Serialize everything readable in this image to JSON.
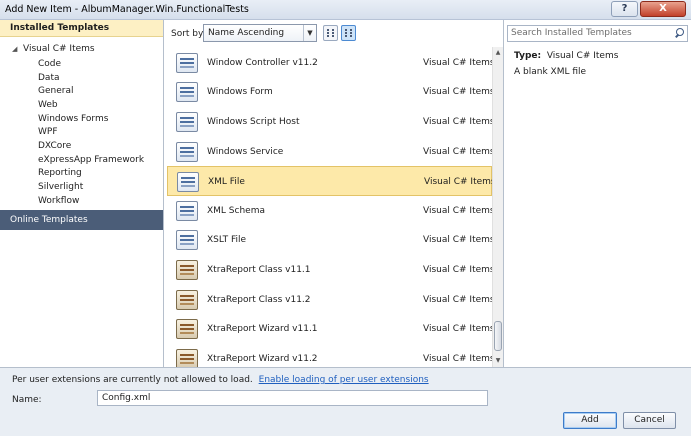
{
  "window": {
    "title": "Add New Item - AlbumManager.Win.FunctionalTests",
    "help_label": "?",
    "close_label": "X"
  },
  "sidebar": {
    "header": "Installed Templates",
    "root_label": "Visual C# Items",
    "items": [
      "Code",
      "Data",
      "General",
      "Web",
      "Windows Forms",
      "WPF",
      "DXCore",
      "eXpressApp Framework",
      "Reporting",
      "Silverlight",
      "Workflow"
    ],
    "online_label": "Online Templates"
  },
  "toolbar": {
    "sort_label": "Sort by:",
    "sort_value": "Name Ascending"
  },
  "templates": [
    {
      "name": "Window Controller v11.2",
      "category": "Visual C# Items",
      "icon": "window-controller-icon",
      "selected": false
    },
    {
      "name": "Windows Form",
      "category": "Visual C# Items",
      "icon": "windows-form-icon",
      "selected": false
    },
    {
      "name": "Windows Script Host",
      "category": "Visual C# Items",
      "icon": "script-host-icon",
      "selected": false
    },
    {
      "name": "Windows Service",
      "category": "Visual C# Items",
      "icon": "windows-service-icon",
      "selected": false
    },
    {
      "name": "XML File",
      "category": "Visual C# Items",
      "icon": "xml-file-icon",
      "selected": true
    },
    {
      "name": "XML Schema",
      "category": "Visual C# Items",
      "icon": "xml-schema-icon",
      "selected": false
    },
    {
      "name": "XSLT File",
      "category": "Visual C# Items",
      "icon": "xslt-file-icon",
      "selected": false
    },
    {
      "name": "XtraReport Class v11.1",
      "category": "Visual C# Items",
      "icon": "xtrareport-class-icon",
      "selected": false
    },
    {
      "name": "XtraReport Class v11.2",
      "category": "Visual C# Items",
      "icon": "xtrareport-class-icon",
      "selected": false
    },
    {
      "name": "XtraReport Wizard v11.1",
      "category": "Visual C# Items",
      "icon": "xtrareport-wizard-icon",
      "selected": false
    },
    {
      "name": "XtraReport Wizard v11.2",
      "category": "Visual C# Items",
      "icon": "xtrareport-wizard-icon",
      "selected": false
    }
  ],
  "details": {
    "search_placeholder": "Search Installed Templates",
    "type_label": "Type:",
    "type_value": "Visual C# Items",
    "description": "A blank XML file"
  },
  "footer": {
    "ext_message": "Per user extensions are currently not allowed to load.",
    "ext_link": "Enable loading of per user extensions",
    "name_label": "Name:",
    "name_value": "Config.xml",
    "add_label": "Add",
    "cancel_label": "Cancel"
  }
}
